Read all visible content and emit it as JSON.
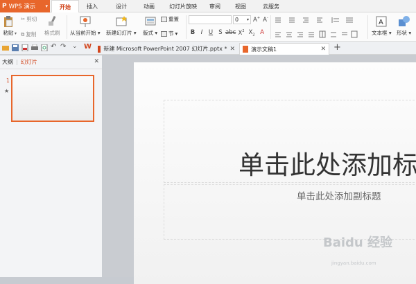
{
  "app": {
    "name": "WPS 演示"
  },
  "menu_tabs": [
    "开始",
    "插入",
    "设计",
    "动画",
    "幻灯片放映",
    "审阅",
    "视图",
    "云服务"
  ],
  "ribbon": {
    "paste": "粘贴",
    "cut": "剪切",
    "copy": "复制",
    "format_painter": "格式刷",
    "from_current": "从当前开始",
    "new_slide": "新建幻灯片",
    "layout": "版式",
    "reset": "重置",
    "section": "节",
    "font_size": "0",
    "text_box": "文本框",
    "shape": "形状"
  },
  "doc_tabs": [
    {
      "label": "新建 Microsoft PowerPoint 2007 幻灯片.pptx *"
    },
    {
      "label": "演示文稿1"
    }
  ],
  "left_panel": {
    "tab_outline": "大纲",
    "tab_slides": "幻灯片",
    "slide_number": "1"
  },
  "slide": {
    "title_placeholder": "单击此处添加标",
    "subtitle_placeholder": "单击此处添加副标题"
  },
  "watermark": {
    "text": "Baidu 经验",
    "url": "jingyan.baidu.com"
  }
}
